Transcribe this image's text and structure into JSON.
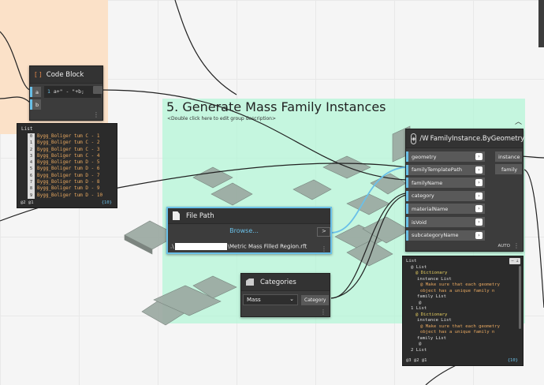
{
  "group": {
    "title": "5. Generate Mass Family Instances",
    "description": "<Double click here to edit group description>"
  },
  "code_block": {
    "title": "Code Block",
    "icon": "code-block-icon",
    "inputs": [
      "a",
      "b"
    ],
    "code": "a+\" - \"+b;"
  },
  "list_preview": {
    "header": "List",
    "items": [
      {
        "index": "0",
        "value": "Bygg_Boliger tum C - 1"
      },
      {
        "index": "1",
        "value": "Bygg_Boliger tum C - 2"
      },
      {
        "index": "2",
        "value": "Bygg_Boliger tum C - 3"
      },
      {
        "index": "3",
        "value": "Bygg_Boliger tum C - 4"
      },
      {
        "index": "4",
        "value": "Bygg_Boliger tum D - 5"
      },
      {
        "index": "5",
        "value": "Bygg_Boliger tum D - 6"
      },
      {
        "index": "6",
        "value": "Bygg_Boliger tum D - 7"
      },
      {
        "index": "7",
        "value": "Bygg_Boliger tum D - 8"
      },
      {
        "index": "8",
        "value": "Bygg_Boliger tum D - 9"
      },
      {
        "index": "9",
        "value": "Bygg_Boliger tum D - 10"
      }
    ],
    "footer_levels": "@2 @1",
    "footer_count": "{10}"
  },
  "family_instance": {
    "title": "FamilyInstance.ByGeometry",
    "title_prefix": "/W",
    "inputs": [
      "geometry",
      "familyTemplatePath",
      "familyName",
      "category",
      "materialName",
      "isVoid",
      "subcategoryName"
    ],
    "outputs": [
      "instance",
      "family"
    ],
    "lacing": "AUTO"
  },
  "file_path": {
    "title": "File Path",
    "browse_label": "Browse...",
    "path_prefix": ".\\",
    "path_suffix": "\\Metric Mass Filled Region.rft"
  },
  "categories": {
    "title": "Categories",
    "selected": "Mass",
    "output": "Category"
  },
  "dict_preview": {
    "lines": [
      "List",
      "@ List",
      "@ Dictionary",
      "instance List",
      "@ Make sure that each geometry",
      "object has a unique family n",
      "family List",
      "@",
      "1 List",
      "@ Dictionary",
      "instance List",
      "@ Make sure that each geometry",
      "object has a unique family n",
      "family List",
      "@",
      "2 List"
    ],
    "footer_levels": "@3 @2 @1",
    "footer_count": "{10}"
  },
  "colors": {
    "wire_blue": "#6ac0e8",
    "mint": "#b4f5d7",
    "peach": "#fbe1c8"
  }
}
